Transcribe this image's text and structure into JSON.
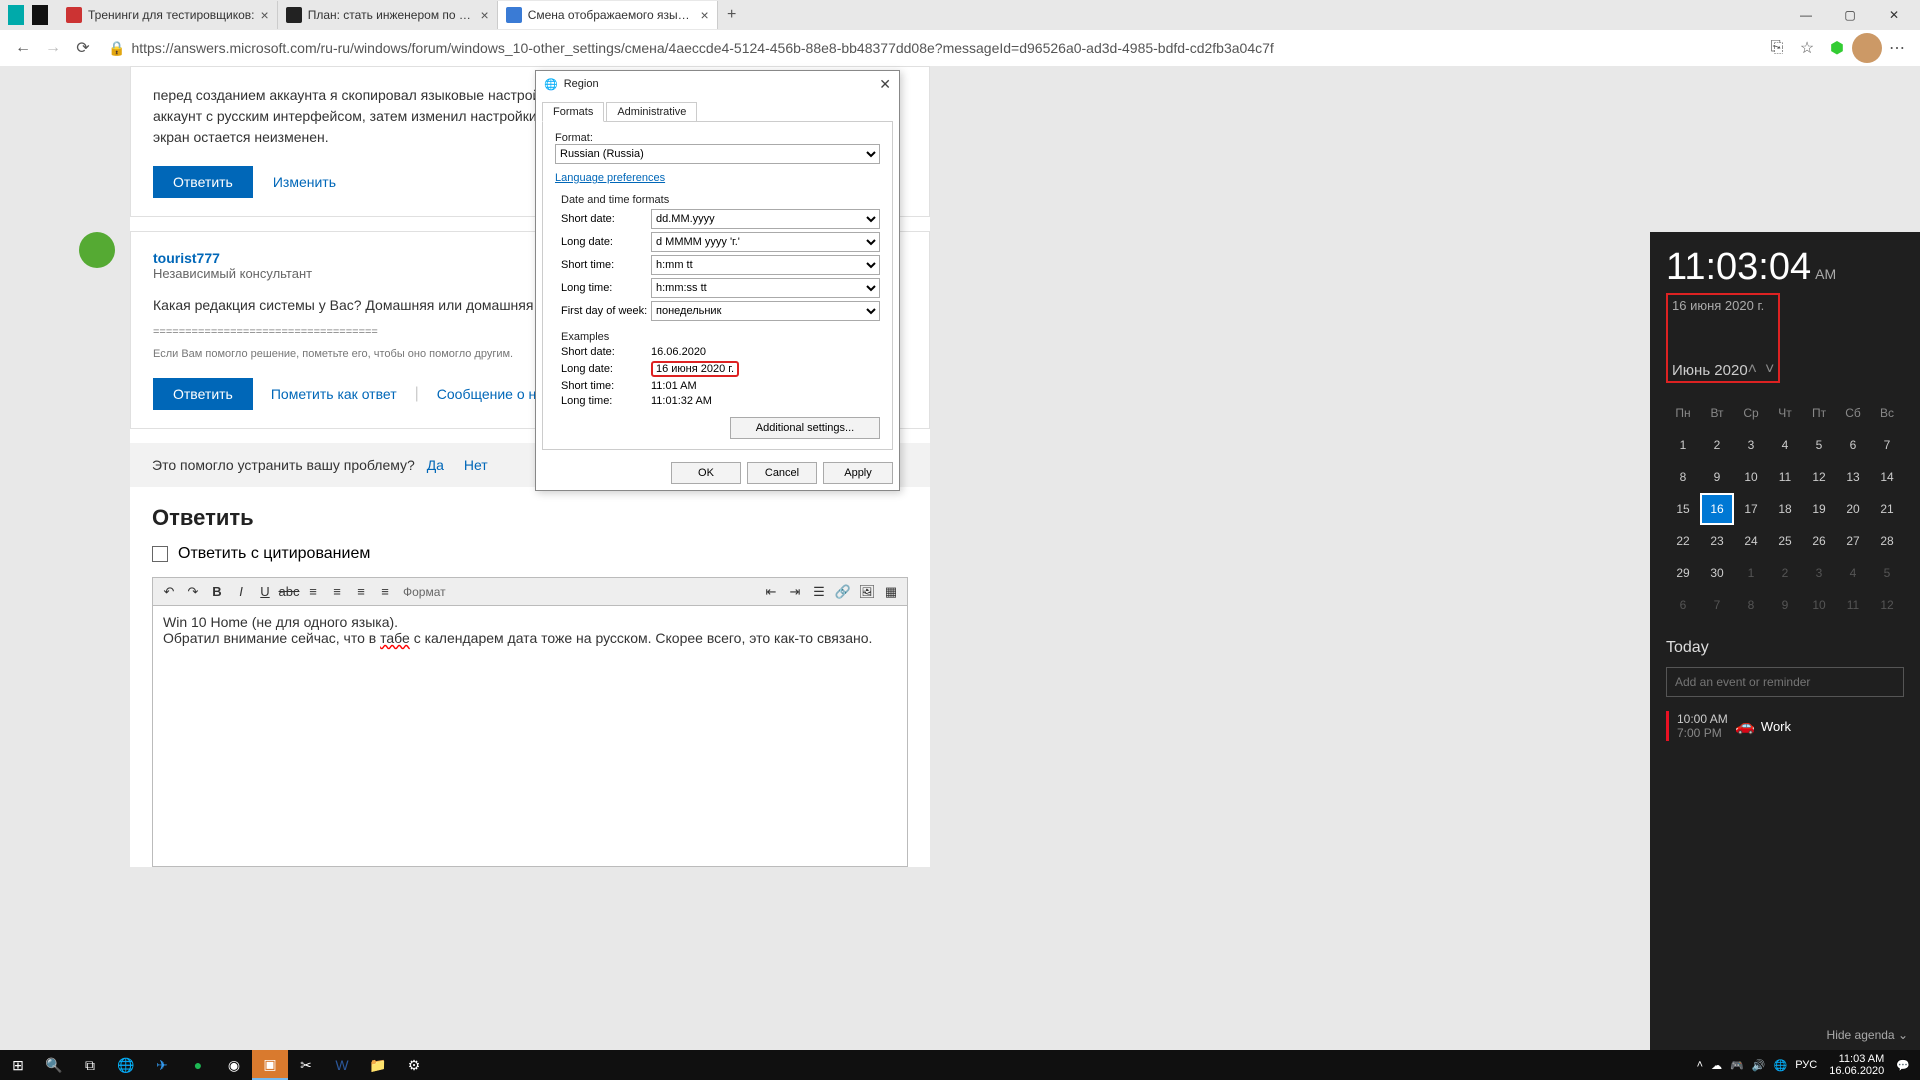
{
  "browser": {
    "tabs": [
      {
        "title": ""
      },
      {
        "title": ""
      },
      {
        "title": "Тренинги для тестировщиков:"
      },
      {
        "title": "План: стать инженером по тес"
      },
      {
        "title": "Смена отображаемого языка н"
      }
    ],
    "url": "https://answers.microsoft.com/ru-ru/windows/forum/windows_10-other_settings/смена/4aeccde4-5124-456b-88e8-bb48377dd08e?messageId=d96526a0-ad3d-4985-bdfd-cd2fb3a04c7f"
  },
  "forum": {
    "post1_text": "перед созданием аккаунта я скопировал языковые настройки на него и убедился что они работают сперва создал аккаунт с русским интерфейсом, затем изменил настройки на английский и создал еще раз, но приветственный экран остается неизменен.",
    "reply_btn": "Ответить",
    "edit_link": "Изменить",
    "user": "tourist777",
    "user_sub": "Независимый консультант",
    "post2_text": "Какая редакция системы у Вас? Домашняя или домашняя для одного язы",
    "sep": "===================================",
    "sep2": "Если Вам помогло решение, пометьте его, чтобы оно помогло другим.",
    "mark_answer": "Пометить как ответ",
    "report": "Сообщение о нарушении",
    "helpful_q": "Это помогло устранить вашу проблему?",
    "yes": "Да",
    "no": "Нет",
    "reply_heading": "Ответить",
    "quote_checkbox": "Ответить с цитированием",
    "format_label": "Формат",
    "editor_line1": "Win 10 Home (не для одного языка).",
    "editor_line2a": "Обратил внимание сейчас, что в ",
    "editor_line2b": "табе",
    "editor_line2c": " с календарем дата тоже на русском. Скорее всего, это как-то связано."
  },
  "dialog": {
    "title": "Region",
    "tab_formats": "Formats",
    "tab_admin": "Administrative",
    "format_label": "Format:",
    "format_value": "Russian (Russia)",
    "lang_pref": "Language preferences",
    "dt_header": "Date and time formats",
    "short_date_lbl": "Short date:",
    "short_date_val": "dd.MM.yyyy",
    "long_date_lbl": "Long date:",
    "long_date_val": "d MMMM yyyy 'г.'",
    "short_time_lbl": "Short time:",
    "short_time_val": "h:mm tt",
    "long_time_lbl": "Long time:",
    "long_time_val": "h:mm:ss tt",
    "first_day_lbl": "First day of week:",
    "first_day_val": "понедельник",
    "examples_header": "Examples",
    "ex_short_date": "16.06.2020",
    "ex_long_date": "16 июня 2020 г.",
    "ex_short_time": "11:01 AM",
    "ex_long_time": "11:01:32 AM",
    "addl": "Additional settings...",
    "ok": "OK",
    "cancel": "Cancel",
    "apply": "Apply"
  },
  "flyout": {
    "time": "11:03:04",
    "ampm": "AM",
    "full_date": "16 июня 2020 г.",
    "month": "Июнь 2020",
    "dow": [
      "Пн",
      "Вт",
      "Ср",
      "Чт",
      "Пт",
      "Сб",
      "Вс"
    ],
    "weeks": [
      [
        {
          "d": "1"
        },
        {
          "d": "2"
        },
        {
          "d": "3"
        },
        {
          "d": "4"
        },
        {
          "d": "5"
        },
        {
          "d": "6"
        },
        {
          "d": "7"
        }
      ],
      [
        {
          "d": "8"
        },
        {
          "d": "9"
        },
        {
          "d": "10"
        },
        {
          "d": "11"
        },
        {
          "d": "12"
        },
        {
          "d": "13"
        },
        {
          "d": "14"
        }
      ],
      [
        {
          "d": "15"
        },
        {
          "d": "16",
          "today": true
        },
        {
          "d": "17"
        },
        {
          "d": "18"
        },
        {
          "d": "19"
        },
        {
          "d": "20"
        },
        {
          "d": "21"
        }
      ],
      [
        {
          "d": "22"
        },
        {
          "d": "23"
        },
        {
          "d": "24"
        },
        {
          "d": "25"
        },
        {
          "d": "26"
        },
        {
          "d": "27"
        },
        {
          "d": "28"
        }
      ],
      [
        {
          "d": "29"
        },
        {
          "d": "30"
        },
        {
          "d": "1",
          "dim": true
        },
        {
          "d": "2",
          "dim": true
        },
        {
          "d": "3",
          "dim": true
        },
        {
          "d": "4",
          "dim": true
        },
        {
          "d": "5",
          "dim": true
        }
      ],
      [
        {
          "d": "6",
          "dim": true
        },
        {
          "d": "7",
          "dim": true
        },
        {
          "d": "8",
          "dim": true
        },
        {
          "d": "9",
          "dim": true
        },
        {
          "d": "10",
          "dim": true
        },
        {
          "d": "11",
          "dim": true
        },
        {
          "d": "12",
          "dim": true
        }
      ]
    ],
    "today_label": "Today",
    "add_event_ph": "Add an event or reminder",
    "event_time1": "10:00 AM",
    "event_time2": "7:00 PM",
    "event_title": "Work",
    "hide_agenda": "Hide agenda ⌄"
  },
  "taskbar": {
    "lang": "РУС",
    "clock_time": "11:03 AM",
    "clock_date": "16.06.2020"
  }
}
